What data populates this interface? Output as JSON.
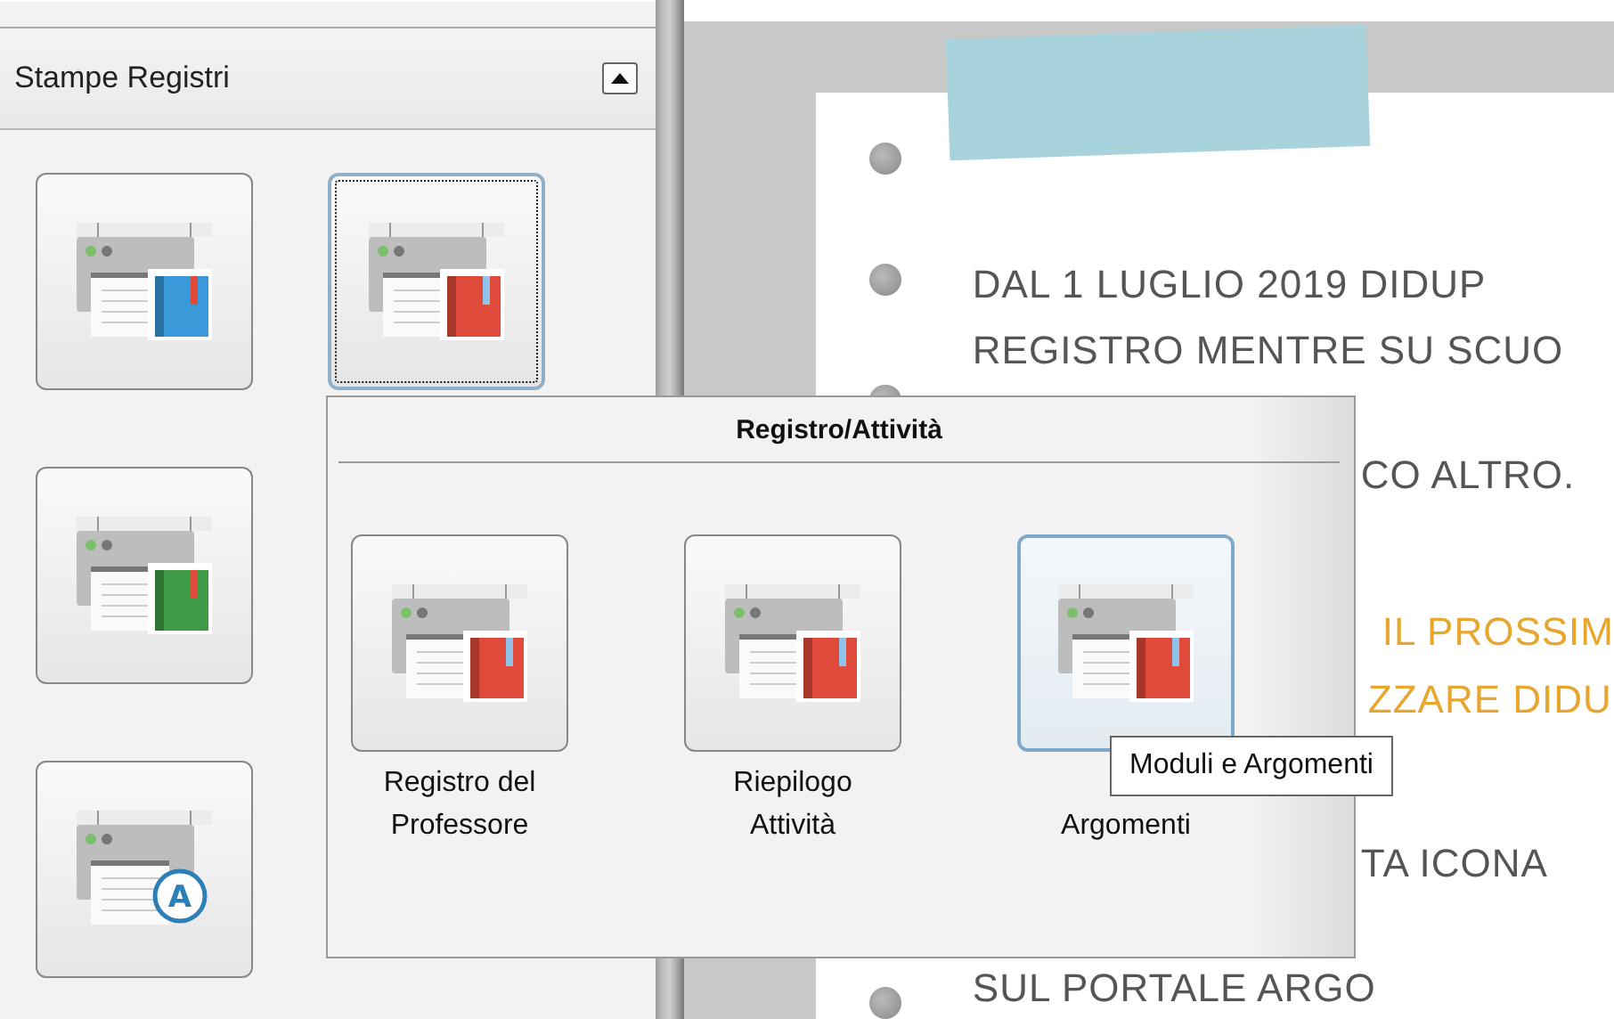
{
  "panel": {
    "title": "Stampe Registri",
    "collapse_button": {
      "kind": "collapse"
    },
    "buttons": [
      {
        "kind": "book",
        "color": "#3a9ad9",
        "focused": false
      },
      {
        "kind": "book",
        "color": "#e04a3a",
        "focused": true
      },
      {
        "kind": "book",
        "color": "#3f9a45",
        "focused": false
      },
      {
        "kind": "letter",
        "letter": "A",
        "focused": false
      }
    ]
  },
  "note": {
    "lines": [
      {
        "text": "DAL 1 LUGLIO 2019 DIDUP",
        "kind": "plain"
      },
      {
        "text": "REGISTRO MENTRE SU SCUO",
        "kind": "plain"
      },
      {
        "text": "CO ALTRO.",
        "kind": "plain"
      },
      {
        "text": "IL PROSSIM",
        "kind": "accent"
      },
      {
        "text": "ZZARE DIDU",
        "kind": "accent"
      },
      {
        "text": "TA ICONA",
        "kind": "plain"
      },
      {
        "text": "SUL PORTALE ARGO",
        "kind": "plain"
      }
    ]
  },
  "popup": {
    "title": "Registro/Attività",
    "items": [
      {
        "label": "Registro del Professore",
        "color": "#e04a3a",
        "hovered": false
      },
      {
        "label": "Riepilogo Attività",
        "color": "#e04a3a",
        "hovered": false
      },
      {
        "label": "Argomenti",
        "color": "#e04a3a",
        "hovered": true
      }
    ]
  },
  "tooltip": {
    "text": "Moduli e Argomenti"
  }
}
